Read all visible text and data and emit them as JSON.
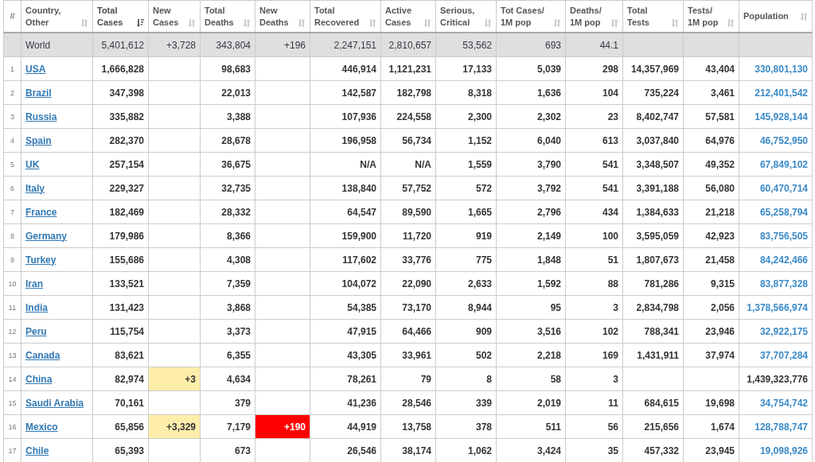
{
  "table": {
    "columns": [
      {
        "label": "#",
        "kind": "index",
        "sortable": false
      },
      {
        "label": "Country,\nOther",
        "kind": "country",
        "sortable": true,
        "sorted": false
      },
      {
        "label": "Total\nCases",
        "kind": "number",
        "sortable": true,
        "sorted": true
      },
      {
        "label": "New\nCases",
        "kind": "new_cases",
        "sortable": true,
        "sorted": false
      },
      {
        "label": "Total\nDeaths",
        "kind": "number",
        "sortable": true,
        "sorted": false
      },
      {
        "label": "New\nDeaths",
        "kind": "new_deaths",
        "sortable": true,
        "sorted": false
      },
      {
        "label": "Total\nRecovered",
        "kind": "number",
        "sortable": true,
        "sorted": false
      },
      {
        "label": "Active\nCases",
        "kind": "number",
        "sortable": true,
        "sorted": false
      },
      {
        "label": "Serious,\nCritical",
        "kind": "number",
        "sortable": true,
        "sorted": false
      },
      {
        "label": "Tot Cases/\n1M pop",
        "kind": "number",
        "sortable": true,
        "sorted": false
      },
      {
        "label": "Deaths/\n1M pop",
        "kind": "number",
        "sortable": true,
        "sorted": false
      },
      {
        "label": "Total\nTests",
        "kind": "number",
        "sortable": true,
        "sorted": false
      },
      {
        "label": "Tests/\n1M pop",
        "kind": "number",
        "sortable": true,
        "sorted": false
      },
      {
        "label": "Population",
        "kind": "population",
        "sortable": true,
        "sorted": false
      }
    ],
    "rows": [
      {
        "kind": "total",
        "cells": [
          "",
          "World",
          "5,401,612",
          "+3,728",
          "343,804",
          "+196",
          "2,247,151",
          "2,810,657",
          "53,562",
          "693",
          "44.1",
          "",
          "",
          ""
        ]
      },
      {
        "kind": "country",
        "cells": [
          "1",
          "USA",
          "1,666,828",
          "",
          "98,683",
          "",
          "446,914",
          "1,121,231",
          "17,133",
          "5,039",
          "298",
          "14,357,969",
          "43,404",
          "330,801,130"
        ],
        "population_linked": true
      },
      {
        "kind": "country",
        "cells": [
          "2",
          "Brazil",
          "347,398",
          "",
          "22,013",
          "",
          "142,587",
          "182,798",
          "8,318",
          "1,636",
          "104",
          "735,224",
          "3,461",
          "212,401,542"
        ],
        "population_linked": true
      },
      {
        "kind": "country",
        "cells": [
          "3",
          "Russia",
          "335,882",
          "",
          "3,388",
          "",
          "107,936",
          "224,558",
          "2,300",
          "2,302",
          "23",
          "8,402,747",
          "57,581",
          "145,928,144"
        ],
        "population_linked": true
      },
      {
        "kind": "country",
        "cells": [
          "4",
          "Spain",
          "282,370",
          "",
          "28,678",
          "",
          "196,958",
          "56,734",
          "1,152",
          "6,040",
          "613",
          "3,037,840",
          "64,976",
          "46,752,950"
        ],
        "population_linked": true
      },
      {
        "kind": "country",
        "cells": [
          "5",
          "UK",
          "257,154",
          "",
          "36,675",
          "",
          "N/A",
          "N/A",
          "1,559",
          "3,790",
          "541",
          "3,348,507",
          "49,352",
          "67,849,102"
        ],
        "population_linked": true
      },
      {
        "kind": "country",
        "cells": [
          "6",
          "Italy",
          "229,327",
          "",
          "32,735",
          "",
          "138,840",
          "57,752",
          "572",
          "3,792",
          "541",
          "3,391,188",
          "56,080",
          "60,470,714"
        ],
        "population_linked": true
      },
      {
        "kind": "country",
        "cells": [
          "7",
          "France",
          "182,469",
          "",
          "28,332",
          "",
          "64,547",
          "89,590",
          "1,665",
          "2,796",
          "434",
          "1,384,633",
          "21,218",
          "65,258,794"
        ],
        "population_linked": true
      },
      {
        "kind": "country",
        "cells": [
          "8",
          "Germany",
          "179,986",
          "",
          "8,366",
          "",
          "159,900",
          "11,720",
          "919",
          "2,149",
          "100",
          "3,595,059",
          "42,923",
          "83,756,505"
        ],
        "population_linked": true
      },
      {
        "kind": "country",
        "cells": [
          "9",
          "Turkey",
          "155,686",
          "",
          "4,308",
          "",
          "117,602",
          "33,776",
          "775",
          "1,848",
          "51",
          "1,807,673",
          "21,458",
          "84,242,466"
        ],
        "population_linked": true
      },
      {
        "kind": "country",
        "cells": [
          "10",
          "Iran",
          "133,521",
          "",
          "7,359",
          "",
          "104,072",
          "22,090",
          "2,633",
          "1,592",
          "88",
          "781,286",
          "9,315",
          "83,877,328"
        ],
        "population_linked": true
      },
      {
        "kind": "country",
        "cells": [
          "11",
          "India",
          "131,423",
          "",
          "3,868",
          "",
          "54,385",
          "73,170",
          "8,944",
          "95",
          "3",
          "2,834,798",
          "2,056",
          "1,378,566,974"
        ],
        "population_linked": true
      },
      {
        "kind": "country",
        "cells": [
          "12",
          "Peru",
          "115,754",
          "",
          "3,373",
          "",
          "47,915",
          "64,466",
          "909",
          "3,516",
          "102",
          "788,341",
          "23,946",
          "32,922,175"
        ],
        "population_linked": true
      },
      {
        "kind": "country",
        "cells": [
          "13",
          "Canada",
          "83,621",
          "",
          "6,355",
          "",
          "43,305",
          "33,961",
          "502",
          "2,218",
          "169",
          "1,431,911",
          "37,974",
          "37,707,284"
        ],
        "population_linked": true
      },
      {
        "kind": "country",
        "cells": [
          "14",
          "China",
          "82,974",
          "+3",
          "4,634",
          "",
          "78,261",
          "79",
          "8",
          "58",
          "3",
          "",
          "",
          "1,439,323,776"
        ],
        "population_linked": false
      },
      {
        "kind": "country",
        "cells": [
          "15",
          "Saudi Arabia",
          "70,161",
          "",
          "379",
          "",
          "41,236",
          "28,546",
          "339",
          "2,019",
          "11",
          "684,615",
          "19,698",
          "34,754,742"
        ],
        "population_linked": true
      },
      {
        "kind": "country",
        "cells": [
          "16",
          "Mexico",
          "65,856",
          "+3,329",
          "7,179",
          "+190",
          "44,919",
          "13,758",
          "378",
          "511",
          "56",
          "215,656",
          "1,674",
          "128,788,747"
        ],
        "population_linked": true
      },
      {
        "kind": "country",
        "cells": [
          "17",
          "Chile",
          "65,393",
          "",
          "673",
          "",
          "26,546",
          "38,174",
          "1,062",
          "3,424",
          "35",
          "457,332",
          "23,945",
          "19,098,926"
        ],
        "population_linked": true
      }
    ]
  }
}
